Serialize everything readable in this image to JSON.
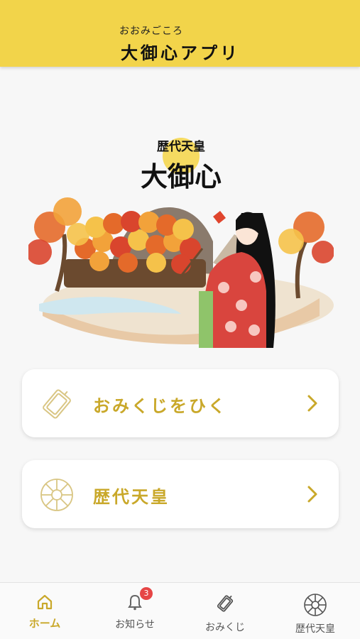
{
  "header": {
    "ruby": "おおみごころ",
    "title": "大御心アプリ"
  },
  "hero": {
    "subtitle": "歴代天皇",
    "logo": "大御心"
  },
  "cards": [
    {
      "label": "おみくじをひく",
      "icon": "omikuji-icon"
    },
    {
      "label": "歴代天皇",
      "icon": "chrysanthemum-icon"
    }
  ],
  "tabs": [
    {
      "label": "ホーム",
      "icon": "home-icon",
      "active": true
    },
    {
      "label": "お知らせ",
      "icon": "bell-icon",
      "badge": "3"
    },
    {
      "label": "おみくじ",
      "icon": "omikuji-icon"
    },
    {
      "label": "歴代天皇",
      "icon": "chrysanthemum-icon"
    }
  ],
  "colors": {
    "header_bg": "#f2d44a",
    "accent": "#c9a82a",
    "badge": "#e64545"
  }
}
